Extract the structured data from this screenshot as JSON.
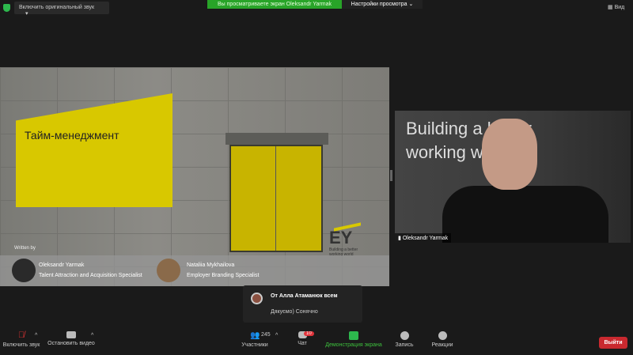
{
  "topbar": {
    "original_sound": "Включить оригинальный звук",
    "viewing": "Вы просматриваете экран Oleksandr Yarmak",
    "view_settings": "Настройки просмотра",
    "view": "Вид"
  },
  "slide": {
    "title": "Тайм-менеджмент",
    "written_by": "Written by",
    "authors": [
      {
        "name": "Oleksandr Yarmak",
        "role": "Talent Attraction and Acquisition Specialist"
      },
      {
        "name": "Nataliia Mykhailova",
        "role": "Employer Branding Specialist"
      }
    ],
    "logo": "EY",
    "logo_tagline": "Building a better working world"
  },
  "video": {
    "name": "Oleksandr Yarmak",
    "background_text": "Building a better working world"
  },
  "chat_popup": {
    "from": "От Алла Атаманюк всем",
    "message": "Дякуємо) Сонячно"
  },
  "toolbar": {
    "unmute": "Включить звук",
    "stop_video": "Остановить видео",
    "participants": "Участники",
    "participants_count": "245",
    "chat": "Чат",
    "chat_badge": "10",
    "share": "Демонстрация экрана",
    "record": "Запись",
    "reactions": "Реакции",
    "leave": "Выйти"
  }
}
